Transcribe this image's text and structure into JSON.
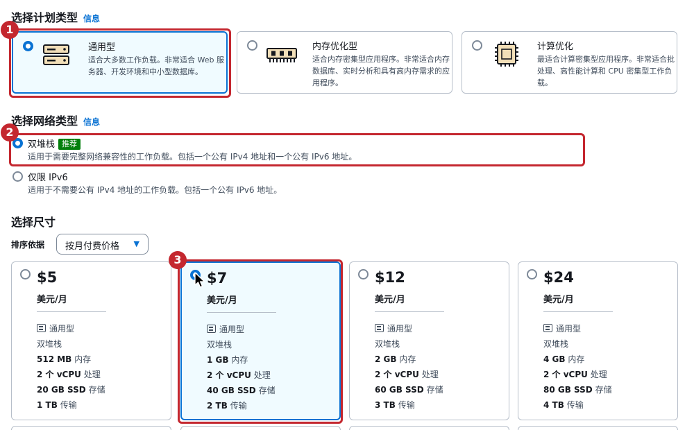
{
  "plan_section": {
    "title": "选择计划类型",
    "info": "信息",
    "plans": [
      {
        "name": "通用型",
        "desc": "适合大多数工作负载。非常适合 Web 服务器、开发环境和中小型数据库。",
        "icon": "server-icon",
        "selected": true
      },
      {
        "name": "内存优化型",
        "desc": "适合内存密集型应用程序。非常适合内存数据库、实时分析和具有高内存需求的应用程序。",
        "icon": "memory-icon",
        "selected": false
      },
      {
        "name": "计算优化",
        "desc": "最适合计算密集型应用程序。非常适合批处理、高性能计算和 CPU 密集型工作负载。",
        "icon": "cpu-chip-icon",
        "selected": false
      }
    ]
  },
  "network_section": {
    "title": "选择网络类型",
    "info": "信息",
    "options": [
      {
        "label": "双堆栈",
        "badge": "推荐",
        "desc": "适用于需要完整网络兼容性的工作负载。包括一个公有 IPv4 地址和一个公有 IPv6 地址。",
        "selected": true
      },
      {
        "label": "仅限 IPv6",
        "badge": "",
        "desc": "适用于不需要公有 IPv4 地址的工作负载。包括一个公有 IPv6 地址。",
        "selected": false
      }
    ]
  },
  "size_section": {
    "title": "选择尺寸",
    "sort_label": "排序依据",
    "sort_value": "按月付费价格",
    "sizes": [
      {
        "price": "$5",
        "unit": "美元/月",
        "type": "通用型",
        "network": "双堆栈",
        "memory_val": "512 MB",
        "memory_lbl": "内存",
        "cpu_val": "2 个 vCPU",
        "cpu_lbl": "处理",
        "storage_val": "20 GB SSD",
        "storage_lbl": "存储",
        "transfer_val": "1 TB",
        "transfer_lbl": "传输",
        "selected": false
      },
      {
        "price": "$7",
        "unit": "美元/月",
        "type": "通用型",
        "network": "双堆栈",
        "memory_val": "1 GB",
        "memory_lbl": "内存",
        "cpu_val": "2 个 vCPU",
        "cpu_lbl": "处理",
        "storage_val": "40 GB SSD",
        "storage_lbl": "存储",
        "transfer_val": "2 TB",
        "transfer_lbl": "传输",
        "selected": true
      },
      {
        "price": "$12",
        "unit": "美元/月",
        "type": "通用型",
        "network": "双堆栈",
        "memory_val": "2 GB",
        "memory_lbl": "内存",
        "cpu_val": "2 个 vCPU",
        "cpu_lbl": "处理",
        "storage_val": "60 GB SSD",
        "storage_lbl": "存储",
        "transfer_val": "3 TB",
        "transfer_lbl": "传输",
        "selected": false
      },
      {
        "price": "$24",
        "unit": "美元/月",
        "type": "通用型",
        "network": "双堆栈",
        "memory_val": "4 GB",
        "memory_lbl": "内存",
        "cpu_val": "2 个 vCPU",
        "cpu_lbl": "处理",
        "storage_val": "80 GB SSD",
        "storage_lbl": "存储",
        "transfer_val": "4 TB",
        "transfer_lbl": "传输",
        "selected": false
      }
    ]
  },
  "annotations": {
    "step1": "1",
    "step2": "2",
    "step3": "3"
  },
  "colors": {
    "accent": "#0972d3",
    "highlight": "#c4272f",
    "badge": "#037f0c"
  }
}
